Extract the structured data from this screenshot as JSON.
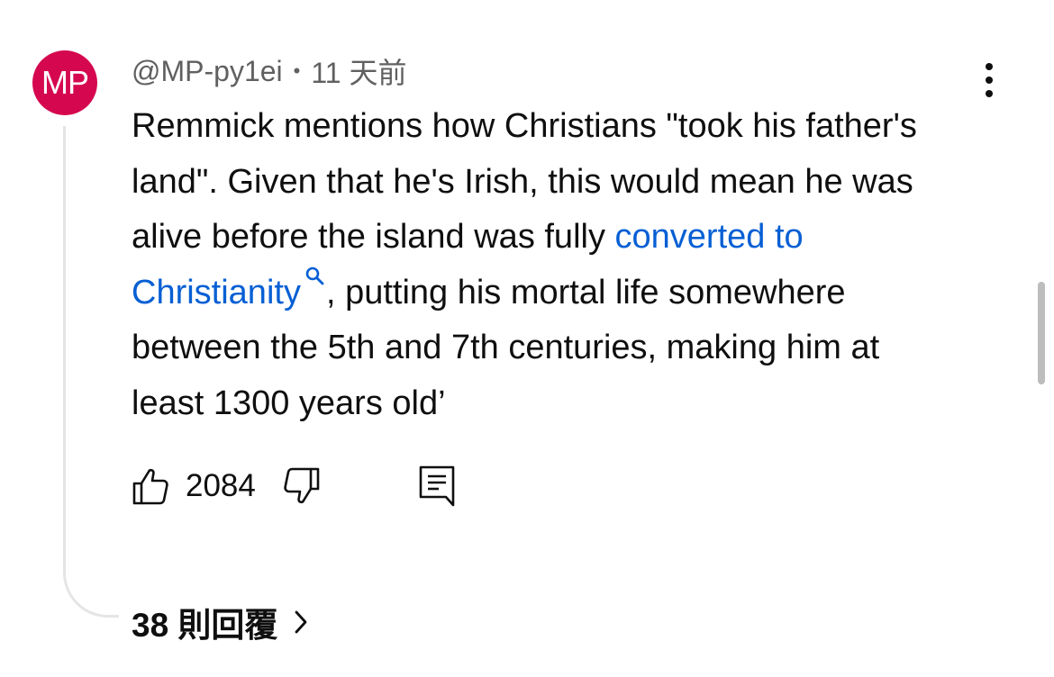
{
  "comment": {
    "avatar_initials": "MP",
    "author": "@MP-py1ei",
    "separator": "•",
    "timestamp": "11 天前",
    "text_before_link": "Remmick mentions how Christians \"took his father's land\". Given that he's Irish, this would mean he was alive before the island was fully ",
    "link_text": "converted to Christianity",
    "text_after_link": ", putting his mortal life somewhere between the 5th and 7th centuries, making him at least 1300 years old’",
    "like_count": "2084",
    "replies_label": "38 則回覆"
  },
  "colors": {
    "avatar_bg": "#d5084f",
    "link": "#065fd4",
    "text": "#0f0f0f",
    "meta": "#606060",
    "thread_line": "#e5e5e5"
  },
  "icons": {
    "like": "thumbs-up-icon",
    "dislike": "thumbs-down-icon",
    "reply": "comment-reply-icon",
    "more": "more-vertical-icon",
    "search": "search-icon",
    "chevron": "chevron-right-icon"
  }
}
